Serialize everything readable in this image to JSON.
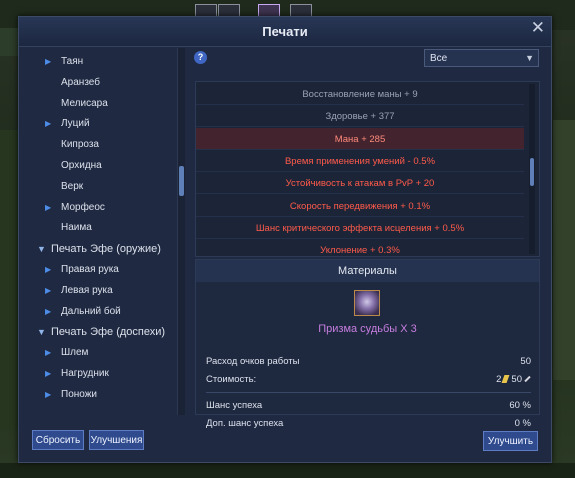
{
  "window": {
    "title": "Печати"
  },
  "tree": [
    {
      "label": "Таян",
      "arrow": true
    },
    {
      "label": "Аранзеб",
      "arrow": false
    },
    {
      "label": "Мелисара",
      "arrow": false
    },
    {
      "label": "Луций",
      "arrow": true
    },
    {
      "label": "Кипроза",
      "arrow": false
    },
    {
      "label": "Орхидна",
      "arrow": false
    },
    {
      "label": "Верк",
      "arrow": false
    },
    {
      "label": "Морфеос",
      "arrow": true
    },
    {
      "label": "Наима",
      "arrow": false
    },
    {
      "label": "Печать Эфе (оружие)",
      "category": true
    },
    {
      "label": "Правая рука",
      "arrow": true
    },
    {
      "label": "Левая рука",
      "arrow": true
    },
    {
      "label": "Дальний бой",
      "arrow": true
    },
    {
      "label": "Печать Эфе (доспехи)",
      "category": true
    },
    {
      "label": "Шлем",
      "arrow": true
    },
    {
      "label": "Нагрудник",
      "arrow": true
    },
    {
      "label": "Поножи",
      "arrow": true
    }
  ],
  "help_label": "?",
  "filter": {
    "selected": "Все"
  },
  "stats": [
    {
      "text": "Восстановление маны + 9",
      "style": "top"
    },
    {
      "text": "Здоровье + 377",
      "style": "top"
    },
    {
      "text": "Мана + 285",
      "style": "sel"
    },
    {
      "text": "Время применения умений - 0.5%",
      "style": "red"
    },
    {
      "text": "Устойчивость к атакам в PvP + 20",
      "style": "red"
    },
    {
      "text": "Скорость передвижения + 0.1%",
      "style": "red"
    },
    {
      "text": "Шанс критического эффекта исцеления + 0.5%",
      "style": "red"
    },
    {
      "text": "Уклонение + 0.3%",
      "style": "red"
    }
  ],
  "materials": {
    "header": "Материалы",
    "item_name": "Призма судьбы X 3",
    "work_points_label": "Расход очков работы",
    "work_points_value": "50",
    "cost_label": "Стоимость:",
    "cost_gold": "2",
    "cost_labor": "50",
    "success_label": "Шанс успеха",
    "success_value": "60 %",
    "extra_success_label": "Доп. шанс успеха",
    "extra_success_value": "0 %"
  },
  "buttons": {
    "reset": "Сбросить",
    "upgrades": "Улучшения",
    "upgrade": "Улучшить"
  },
  "colors": {
    "stat_red": "#ff5a4a",
    "stat_selected_bg": "#43232e",
    "item_name": "#c77ee0",
    "button": "#2f4b8e"
  }
}
